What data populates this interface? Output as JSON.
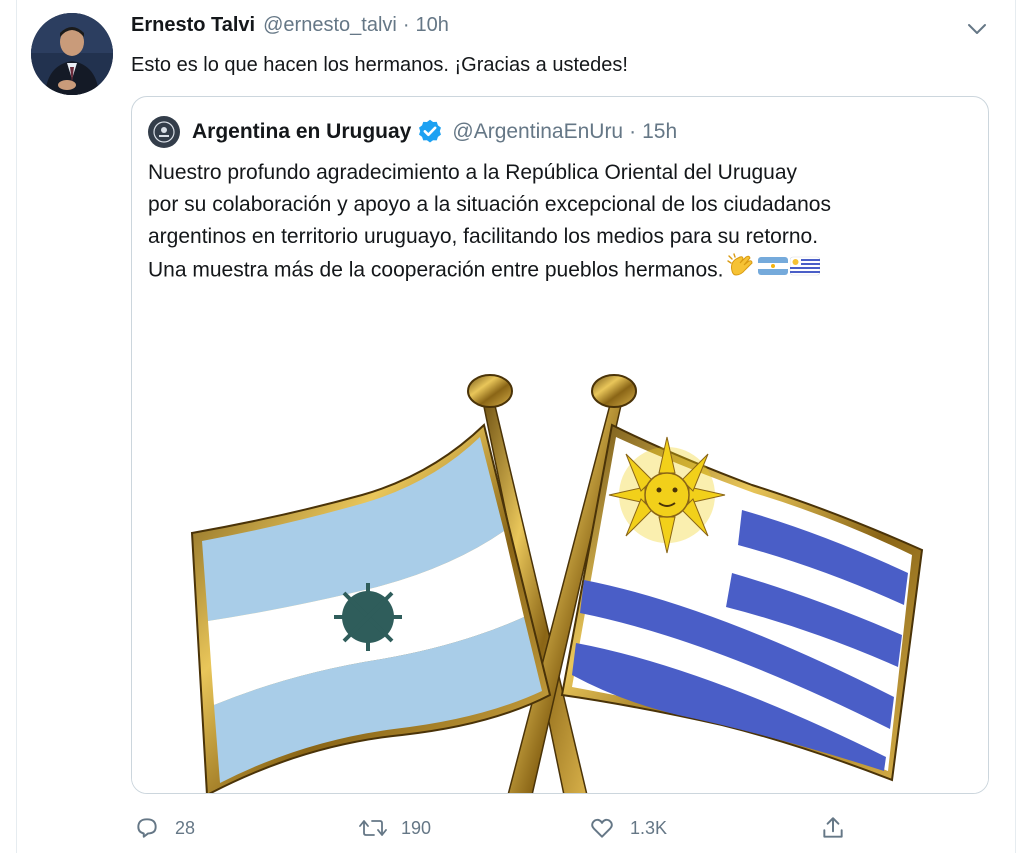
{
  "tweet": {
    "author_name": "Ernesto Talvi",
    "author_handle": "@ernesto_talvi",
    "separator": "·",
    "time": "10h",
    "text": "Esto es lo que hacen los hermanos. ¡Gracias a ustedes!",
    "menu_icon": "chevron-down-icon"
  },
  "quote": {
    "author_name": "Argentina en Uruguay",
    "verified_icon": "verified-badge-icon",
    "author_handle": "@ArgentinaEnUru",
    "separator": "·",
    "time": "15h",
    "lines": [
      "Nuestro profundo agradecimiento a la República Oriental del Uruguay",
      "por su colaboración y apoyo a la situación excepcional de los ciudadanos",
      "argentinos en territorio uruguayo, facilitando los medios para su retorno.",
      "Una muestra más de la cooperación entre pueblos hermanos."
    ],
    "emojis": [
      "clapping-hands-icon",
      "argentina-flag-icon",
      "uruguay-flag-icon"
    ],
    "image": "crossed-flags-pin-argentina-uruguay"
  },
  "actions": {
    "reply_count": "28",
    "retweet_count": "190",
    "like_count": "1.3K"
  },
  "colors": {
    "text": "#14171a",
    "secondary": "#657786",
    "border": "#ccd6dd",
    "verified": "#1da1f2",
    "argentina_blue": "#a9cce6",
    "uruguay_blue": "#4a5ec7",
    "sun": "#f2d01a"
  }
}
